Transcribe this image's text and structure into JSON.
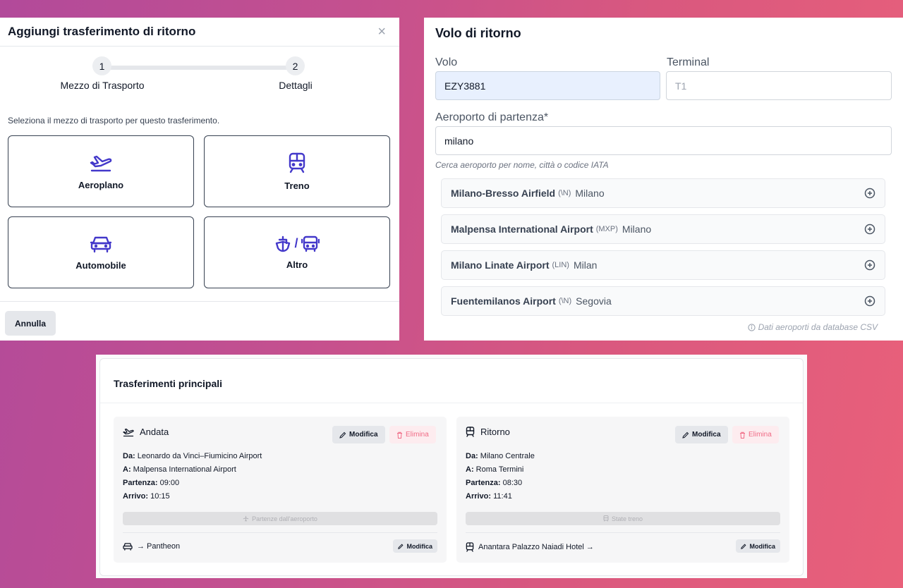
{
  "modal": {
    "title": "Aggiungi trasferimento di ritorno",
    "close_glyph": "×",
    "steps": [
      {
        "number": "1",
        "label": "Mezzo di Trasporto"
      },
      {
        "number": "2",
        "label": "Dettagli"
      }
    ],
    "intro": "Seleziona il mezzo di trasporto per questo trasferimento.",
    "options": [
      {
        "label": "Aeroplano",
        "icon": "plane-departure-icon"
      },
      {
        "label": "Treno",
        "icon": "train-icon"
      },
      {
        "label": "Automobile",
        "icon": "car-icon"
      },
      {
        "label": "Altro",
        "icon": "ship-bus-icon",
        "separator": "/"
      }
    ],
    "cancel_label": "Annulla"
  },
  "return_flight": {
    "title": "Volo di ritorno",
    "flight_label": "Volo",
    "flight_value": "EZY3881",
    "terminal_label": "Terminal",
    "terminal_placeholder": "T1",
    "airport_label": "Aeroporto di partenza*",
    "airport_value": "milano",
    "hint": "Cerca aeroporto per nome, città o codice IATA",
    "results": [
      {
        "name": "Milano-Bresso Airfield",
        "code": "(\\N)",
        "city": "Milano"
      },
      {
        "name": "Malpensa International Airport",
        "code": "(MXP)",
        "city": "Milano"
      },
      {
        "name": "Milano Linate Airport",
        "code": "(LIN)",
        "city": "Milan"
      },
      {
        "name": "Fuentemilanos Airport",
        "code": "(\\N)",
        "city": "Segovia"
      }
    ],
    "source_note": "Dati aeroporti da database CSV"
  },
  "main_transfers": {
    "title": "Trasferimenti principali",
    "cards": [
      {
        "heading": "Andata",
        "icon": "plane-departure-icon",
        "edit_label": "Modifica",
        "delete_label": "Elimina",
        "from_label": "Da:",
        "from": "Leonardo da Vinci–Fiumicino Airport",
        "to_label": "A:",
        "to": "Malpensa International Airport",
        "departure_label": "Partenza:",
        "departure": "09:00",
        "arrival_label": "Arrivo:",
        "arrival": "10:15",
        "status_label": "Partenze dall'aeroporto",
        "status_icon": "plane-icon",
        "footer_text": "→ Pantheon",
        "footer_icon": "car-icon",
        "footer_edit_label": "Modifica"
      },
      {
        "heading": "Ritorno",
        "icon": "train-icon",
        "edit_label": "Modifica",
        "delete_label": "Elimina",
        "from_label": "Da:",
        "from": "Milano Centrale",
        "to_label": "A:",
        "to": "Roma Termini",
        "departure_label": "Partenza:",
        "departure": "08:30",
        "arrival_label": "Arrivo:",
        "arrival": "11:41",
        "status_label": "State treno",
        "status_icon": "train-icon",
        "footer_text": "Anantara Palazzo Naiadi Hotel →",
        "footer_icon": "train-icon",
        "footer_edit_label": "Modifica"
      }
    ]
  },
  "colors": {
    "accent": "#4338ca",
    "danger": "#f06b86",
    "highlight_input": "#e8f0fe"
  }
}
